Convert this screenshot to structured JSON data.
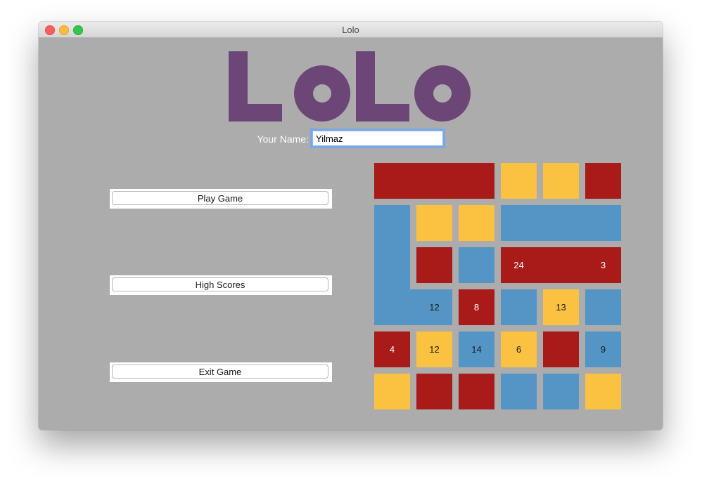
{
  "window": {
    "title": "Lolo"
  },
  "logo": {
    "text": "LoLo",
    "color": "#6d4678"
  },
  "name_field": {
    "label": "Your Name:",
    "value": "Yilmaz"
  },
  "menu": {
    "play": "Play Game",
    "high_scores": "High Scores",
    "exit": "Exit Game"
  },
  "colors": {
    "red": "#a81b19",
    "yellow": "#fbc141",
    "blue": "#5495c6",
    "background": "#acacac"
  },
  "board": {
    "rows": 6,
    "cols": 6,
    "pieces": [
      {
        "color": "red",
        "cells": [
          [
            0,
            0
          ],
          [
            0,
            1
          ],
          [
            0,
            2
          ]
        ]
      },
      {
        "color": "yellow",
        "cells": [
          [
            0,
            3
          ]
        ]
      },
      {
        "color": "yellow",
        "cells": [
          [
            0,
            4
          ]
        ]
      },
      {
        "color": "red",
        "cells": [
          [
            0,
            5
          ]
        ]
      },
      {
        "color": "blue",
        "cells": [
          [
            1,
            0
          ],
          [
            2,
            0
          ],
          [
            3,
            0
          ],
          [
            3,
            1
          ]
        ],
        "number": "12"
      },
      {
        "color": "yellow",
        "cells": [
          [
            1,
            1
          ]
        ]
      },
      {
        "color": "yellow",
        "cells": [
          [
            1,
            2
          ]
        ]
      },
      {
        "color": "blue",
        "cells": [
          [
            1,
            3
          ],
          [
            1,
            4
          ],
          [
            1,
            5
          ]
        ]
      },
      {
        "color": "red",
        "cells": [
          [
            2,
            1
          ]
        ]
      },
      {
        "color": "blue",
        "cells": [
          [
            2,
            2
          ]
        ]
      },
      {
        "color": "red",
        "cells": [
          [
            2,
            3
          ],
          [
            2,
            4
          ],
          [
            2,
            5
          ]
        ],
        "labels": [
          "24",
          "3"
        ]
      },
      {
        "color": "red",
        "cells": [
          [
            3,
            2
          ]
        ],
        "number": "8"
      },
      {
        "color": "blue",
        "cells": [
          [
            3,
            3
          ]
        ]
      },
      {
        "color": "yellow",
        "cells": [
          [
            3,
            4
          ]
        ],
        "number": "13"
      },
      {
        "color": "blue",
        "cells": [
          [
            3,
            5
          ]
        ]
      },
      {
        "color": "red",
        "cells": [
          [
            4,
            0
          ]
        ],
        "number": "4"
      },
      {
        "color": "yellow",
        "cells": [
          [
            4,
            1
          ]
        ],
        "number": "12"
      },
      {
        "color": "blue",
        "cells": [
          [
            4,
            2
          ]
        ],
        "number": "14"
      },
      {
        "color": "yellow",
        "cells": [
          [
            4,
            3
          ]
        ],
        "number": "6"
      },
      {
        "color": "red",
        "cells": [
          [
            4,
            4
          ]
        ]
      },
      {
        "color": "blue",
        "cells": [
          [
            4,
            5
          ]
        ],
        "number": "9"
      },
      {
        "color": "yellow",
        "cells": [
          [
            5,
            0
          ]
        ]
      },
      {
        "color": "red",
        "cells": [
          [
            5,
            1
          ]
        ]
      },
      {
        "color": "red",
        "cells": [
          [
            5,
            2
          ]
        ]
      },
      {
        "color": "blue",
        "cells": [
          [
            5,
            3
          ]
        ]
      },
      {
        "color": "blue",
        "cells": [
          [
            5,
            4
          ]
        ]
      },
      {
        "color": "yellow",
        "cells": [
          [
            5,
            5
          ]
        ]
      }
    ]
  }
}
